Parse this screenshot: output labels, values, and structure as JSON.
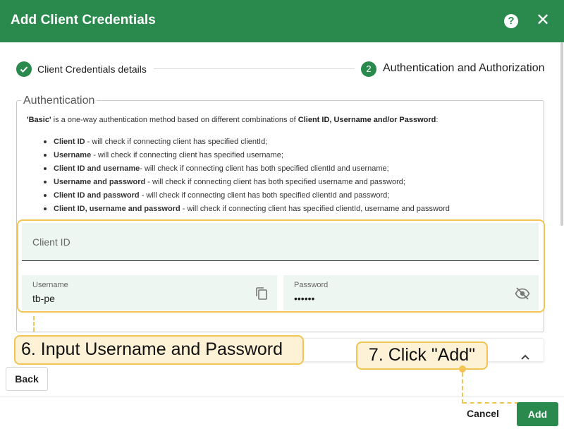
{
  "header": {
    "title": "Add Client Credentials",
    "help_icon": "help-circle-icon",
    "close_icon": "close-icon"
  },
  "stepper": {
    "step1": {
      "label": "Client Credentials details",
      "status": "completed"
    },
    "step2": {
      "number": "2",
      "label": "Authentication and Authorization",
      "status": "active"
    }
  },
  "auth": {
    "legend": "Authentication",
    "desc_bold1": "'Basic'",
    "desc_text1": " is a one-way authentication method based on different combinations of ",
    "desc_bold2": "Client ID, Username and/or Password",
    "desc_text2": ":",
    "bullets": [
      {
        "bold": "Client ID",
        "text": " - will check if connecting client has specified clientId;"
      },
      {
        "bold": "Username",
        "text": " - will check if connecting client has specified username;"
      },
      {
        "bold": "Client ID and username",
        "text": "- will check if connecting client has both specified clientId and username;"
      },
      {
        "bold": "Username and password",
        "text": " - will check if connecting client has both specified username and password;"
      },
      {
        "bold": "Client ID and password",
        "text": " - will check if connecting client has both specified clientId and password;"
      },
      {
        "bold": "Client ID, username and password",
        "text": " - will check if connecting client has specified clientId, username and password"
      }
    ],
    "client_id": {
      "placeholder": "Client ID",
      "value": ""
    },
    "username": {
      "label": "Username",
      "value": "tb-pe"
    },
    "password": {
      "label": "Password",
      "value": "••••••"
    }
  },
  "annotations": {
    "step6": "6. Input Username and Password",
    "step7": "7. Click \"Add\""
  },
  "buttons": {
    "back": "Back",
    "cancel": "Cancel",
    "add": "Add"
  },
  "colors": {
    "primary": "#2a8a4e",
    "annotation": "#f1c453",
    "annotation_bg": "#fdf2d5",
    "field_bg": "#eef6f1"
  }
}
